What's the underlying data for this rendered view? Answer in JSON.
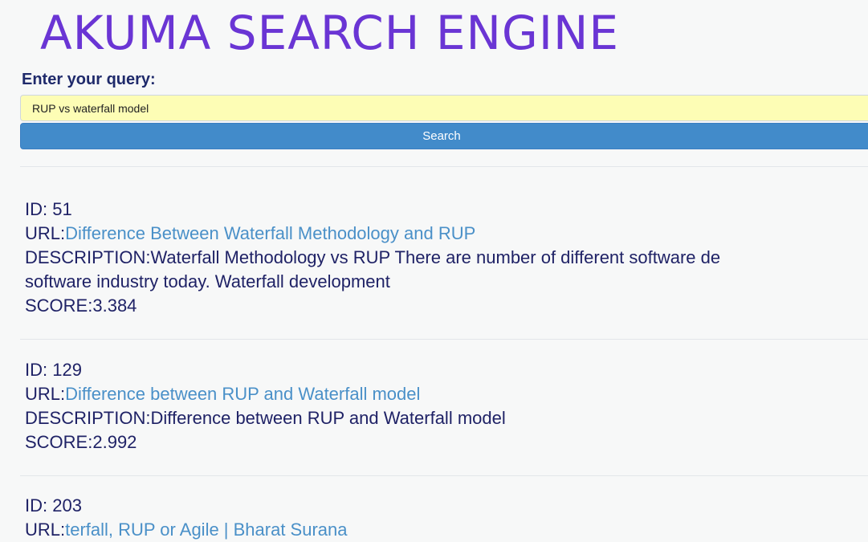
{
  "app": {
    "title": "AKUMA SEARCH ENGINE"
  },
  "search": {
    "label": "Enter your query:",
    "value": "RUP vs waterfall model",
    "button_label": "Search"
  },
  "colors": {
    "title": "#6a35d4",
    "input_bg": "#fdfdb5",
    "button_bg": "#428bca",
    "link": "#4a90c8",
    "text": "#1f2266"
  },
  "results": [
    {
      "id_label": "ID: ",
      "id": "51",
      "url_label": "URL:",
      "url_text": "Difference Between Waterfall Methodology and RUP",
      "desc_label": "DESCRIPTION:",
      "desc_line1": "Waterfall Methodology vs RUP There are number of different software de",
      "desc_line2": "software industry today. Waterfall development",
      "score_label": "SCORE:",
      "score": "3.384"
    },
    {
      "id_label": "ID: ",
      "id": "129",
      "url_label": "URL:",
      "url_text": "Difference between RUP and Waterfall model",
      "desc_label": "DESCRIPTION:",
      "desc_line1": "Difference between RUP and Waterfall model",
      "score_label": "SCORE:",
      "score": "2.992"
    },
    {
      "id_label": "ID: ",
      "id": "203",
      "url_label": "URL:",
      "url_text": "terfall, RUP or Agile | Bharat Surana"
    }
  ]
}
